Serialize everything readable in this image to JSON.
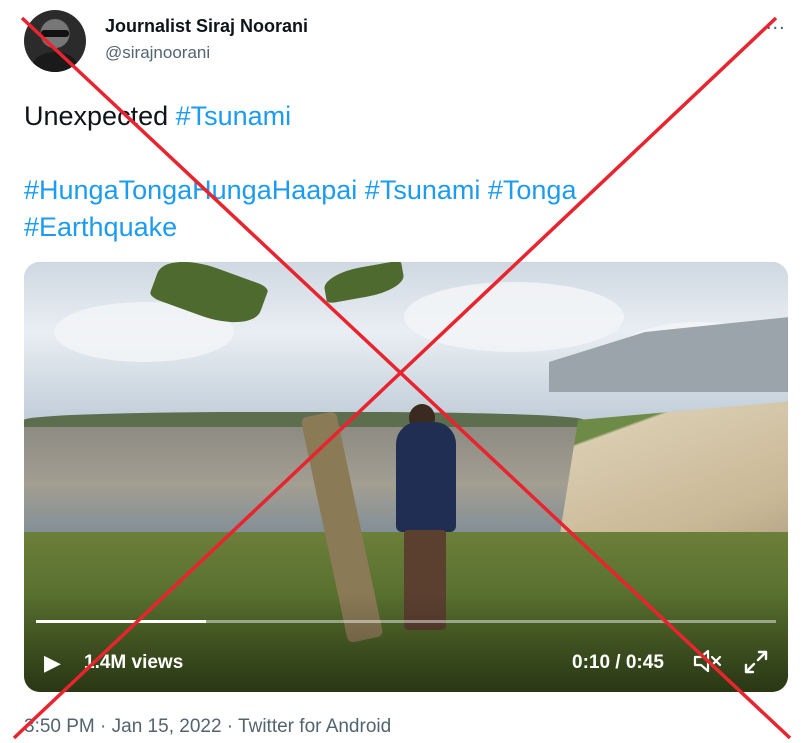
{
  "author": {
    "name": "Journalist Siraj Noorani",
    "handle": "@sirajnoorani",
    "avatar_icon": "avatar-icon"
  },
  "more_icon": "ellipsis-icon",
  "more_label": "...",
  "tweet": {
    "line1_text": "Unexpected ",
    "line1_tag": "#Tsunami",
    "line2_tags": [
      "#HungaTongaHungaHaapai",
      "#Tsunami",
      "#Tonga",
      "#Earthquake"
    ]
  },
  "video": {
    "play_icon": "▶",
    "views": "1.4M views",
    "time": "0:10 / 0:45",
    "progress": 0.23,
    "volume_icon": "volume-muted-icon",
    "expand_icon": "expand-icon"
  },
  "meta": "3:50 PM · Jan 15, 2022 · Twitter for Android",
  "overlay": {
    "type": "red-cross",
    "color": "#e8242e"
  }
}
